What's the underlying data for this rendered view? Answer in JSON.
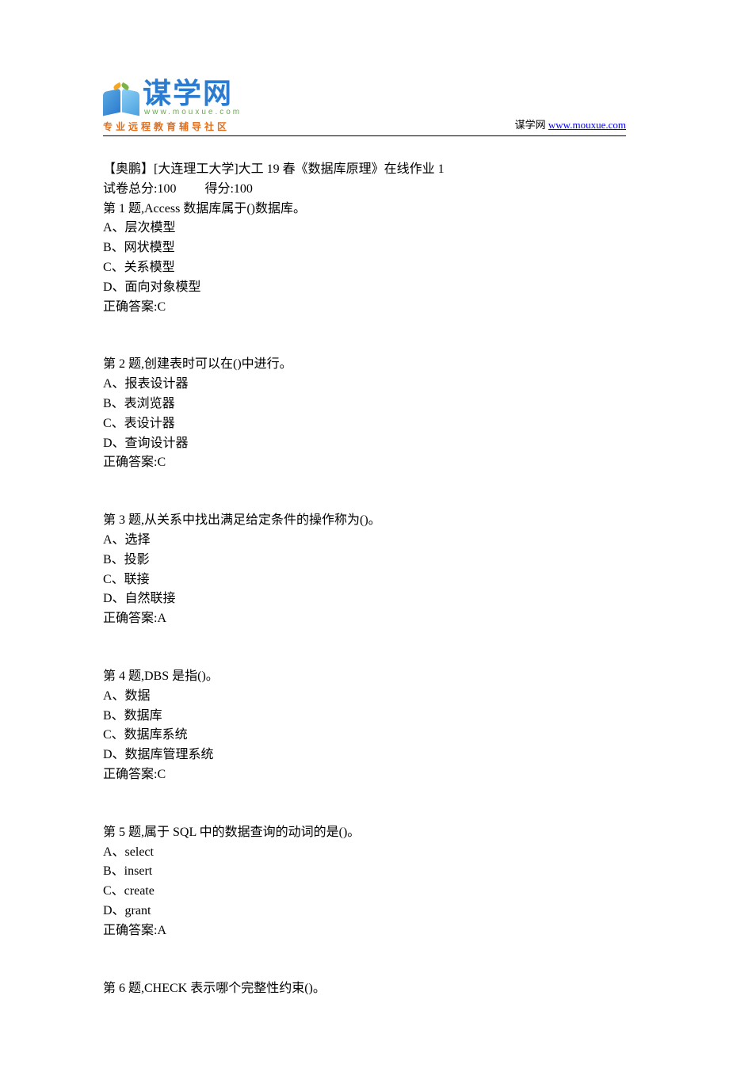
{
  "header": {
    "logo_cn": "谋学网",
    "logo_en": "www.mouxue.com",
    "logo_subtitle": "专业远程教育辅导社区",
    "brand_text": "谋学网 ",
    "brand_url": "www.mouxue.com"
  },
  "title": "【奥鹏】[大连理工大学]大工 19 春《数据库原理》在线作业 1",
  "score_total_label": "试卷总分:100",
  "score_got_label": "得分:100",
  "questions": [
    {
      "stem": "第 1 题,Access 数据库属于()数据库。",
      "options": [
        "A、层次模型",
        "B、网状模型",
        "C、关系模型",
        "D、面向对象模型"
      ],
      "answer": "正确答案:C"
    },
    {
      "stem": "第 2 题,创建表时可以在()中进行。",
      "options": [
        "A、报表设计器",
        "B、表浏览器",
        "C、表设计器",
        "D、查询设计器"
      ],
      "answer": "正确答案:C"
    },
    {
      "stem": "第 3 题,从关系中找出满足给定条件的操作称为()。",
      "options": [
        "A、选择",
        "B、投影",
        "C、联接",
        "D、自然联接"
      ],
      "answer": "正确答案:A"
    },
    {
      "stem": "第 4 题,DBS 是指()。",
      "options": [
        "A、数据",
        "B、数据库",
        "C、数据库系统",
        "D、数据库管理系统"
      ],
      "answer": "正确答案:C"
    },
    {
      "stem": "第 5 题,属于 SQL 中的数据查询的动词的是()。",
      "options": [
        "A、select",
        "B、insert",
        "C、create",
        "D、grant"
      ],
      "answer": "正确答案:A"
    },
    {
      "stem": "第 6 题,CHECK 表示哪个完整性约束()。",
      "options": [],
      "answer": ""
    }
  ]
}
